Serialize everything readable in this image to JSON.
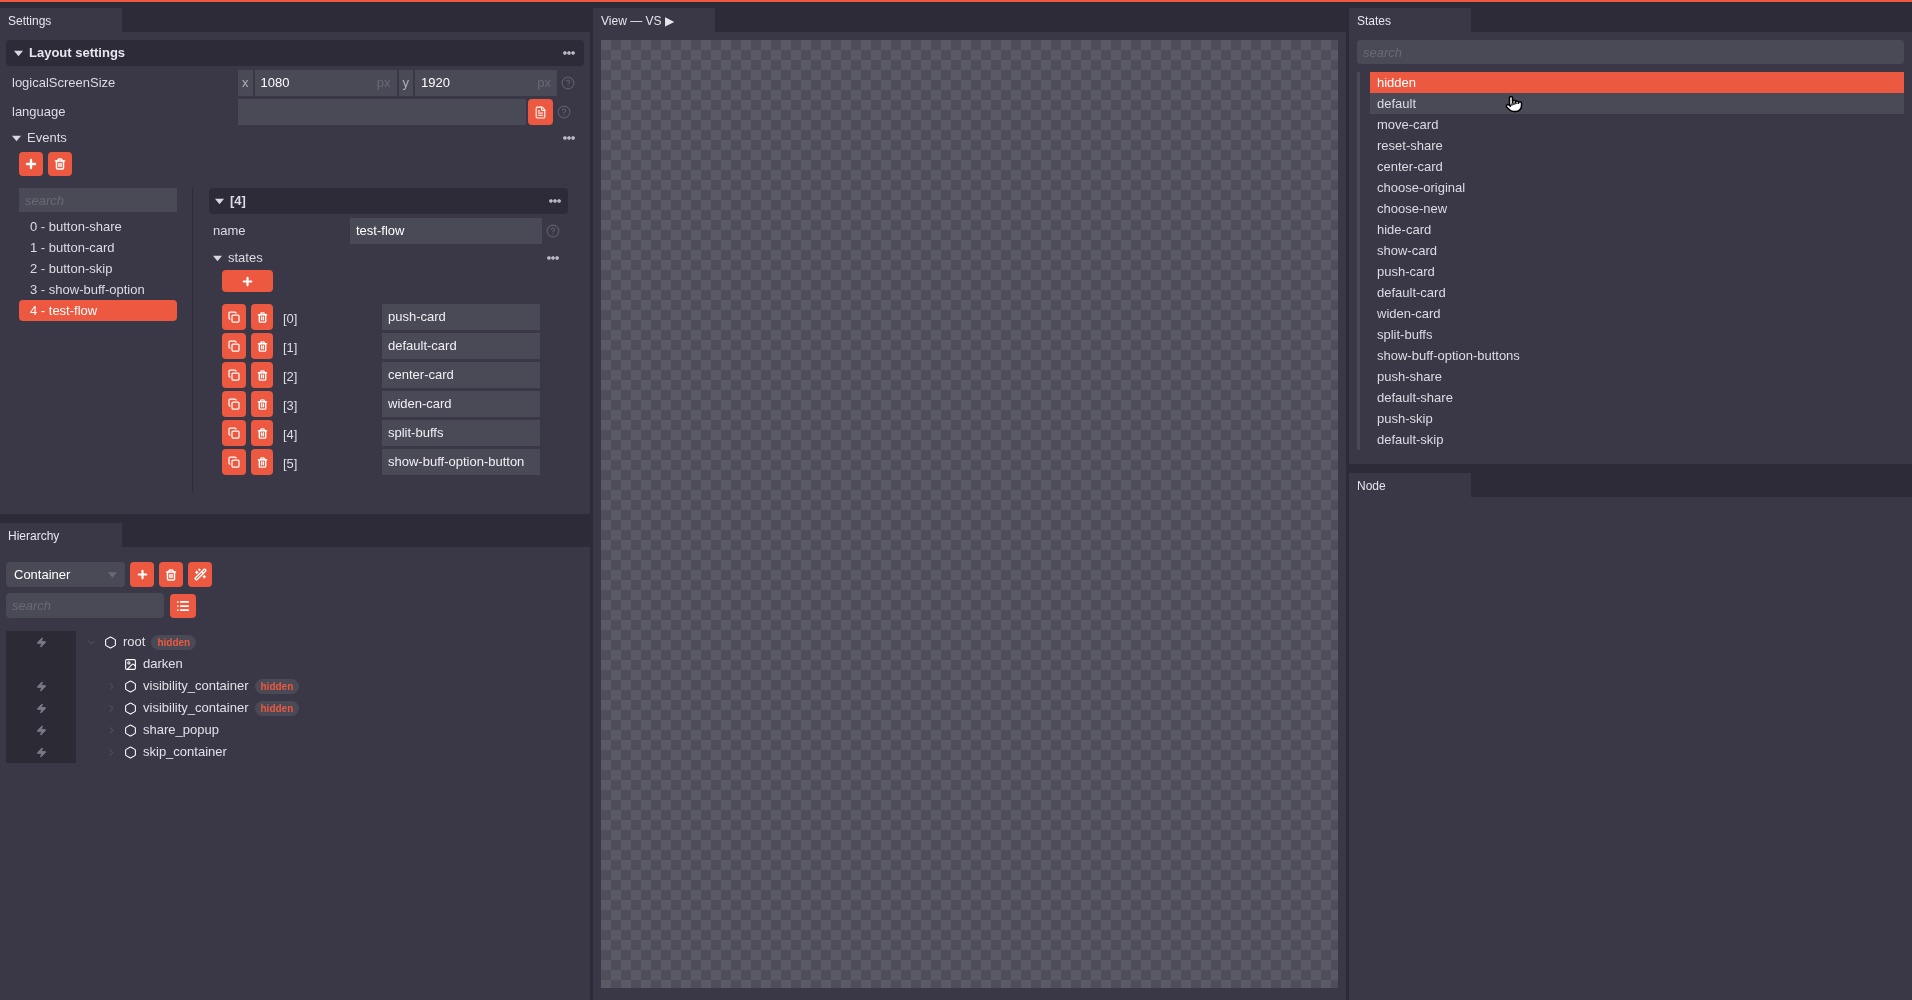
{
  "settings": {
    "tab": "Settings",
    "layout_section": {
      "title": "Layout settings",
      "expanded": true
    },
    "logical_screen_size": {
      "label": "logicalScreenSize",
      "x_label": "x",
      "x_value": "1080",
      "x_unit": "px",
      "y_label": "y",
      "y_value": "1920",
      "y_unit": "px"
    },
    "language": {
      "label": "language"
    },
    "events": {
      "title": "Events",
      "expanded": true,
      "search_placeholder": "search",
      "items": [
        {
          "label": "0 - button-share",
          "selected": false
        },
        {
          "label": "1 - button-card",
          "selected": false
        },
        {
          "label": "2 - button-skip",
          "selected": false
        },
        {
          "label": "3 - show-buff-option",
          "selected": false
        },
        {
          "label": "4 - test-flow",
          "selected": true
        }
      ],
      "detail": {
        "title": "[4]",
        "expanded": true,
        "name_label": "name",
        "name_value": "test-flow",
        "states_title": "states",
        "states_expanded": true,
        "states": [
          {
            "index": "[0]",
            "value": "push-card"
          },
          {
            "index": "[1]",
            "value": "default-card"
          },
          {
            "index": "[2]",
            "value": "center-card"
          },
          {
            "index": "[3]",
            "value": "widen-card"
          },
          {
            "index": "[4]",
            "value": "split-buffs"
          },
          {
            "index": "[5]",
            "value": "show-buff-option-button"
          }
        ]
      }
    }
  },
  "hierarchy": {
    "tab": "Hierarchy",
    "type_select": "Container",
    "search_placeholder": "search",
    "tree": [
      {
        "name": "root",
        "kind": "container",
        "event": true,
        "badge": "hidden",
        "expanded": true,
        "children": [
          {
            "name": "darken",
            "kind": "image",
            "event": false
          },
          {
            "name": "visibility_container",
            "kind": "container",
            "event": true,
            "badge": "hidden",
            "expanded": false
          },
          {
            "name": "visibility_container",
            "kind": "container",
            "event": true,
            "badge": "hidden",
            "expanded": false
          },
          {
            "name": "share_popup",
            "kind": "container",
            "event": true,
            "expanded": false
          },
          {
            "name": "skip_container",
            "kind": "container",
            "event": true,
            "expanded": false
          }
        ]
      }
    ]
  },
  "view": {
    "tab": "View — VS ▶"
  },
  "states": {
    "tab": "States",
    "search_placeholder": "search",
    "items": [
      {
        "label": "hidden",
        "selected": true,
        "hovered": false
      },
      {
        "label": "default",
        "selected": false,
        "hovered": true
      },
      {
        "label": "move-card",
        "selected": false,
        "hovered": false
      },
      {
        "label": "reset-share",
        "selected": false,
        "hovered": false
      },
      {
        "label": "center-card",
        "selected": false,
        "hovered": false
      },
      {
        "label": "choose-original",
        "selected": false,
        "hovered": false
      },
      {
        "label": "choose-new",
        "selected": false,
        "hovered": false
      },
      {
        "label": "hide-card",
        "selected": false,
        "hovered": false
      },
      {
        "label": "show-card",
        "selected": false,
        "hovered": false
      },
      {
        "label": "push-card",
        "selected": false,
        "hovered": false
      },
      {
        "label": "default-card",
        "selected": false,
        "hovered": false
      },
      {
        "label": "widen-card",
        "selected": false,
        "hovered": false
      },
      {
        "label": "split-buffs",
        "selected": false,
        "hovered": false
      },
      {
        "label": "show-buff-option-buttons",
        "selected": false,
        "hovered": false
      },
      {
        "label": "push-share",
        "selected": false,
        "hovered": false
      },
      {
        "label": "default-share",
        "selected": false,
        "hovered": false
      },
      {
        "label": "push-skip",
        "selected": false,
        "hovered": false
      },
      {
        "label": "default-skip",
        "selected": false,
        "hovered": false
      }
    ]
  },
  "node": {
    "tab": "Node"
  }
}
